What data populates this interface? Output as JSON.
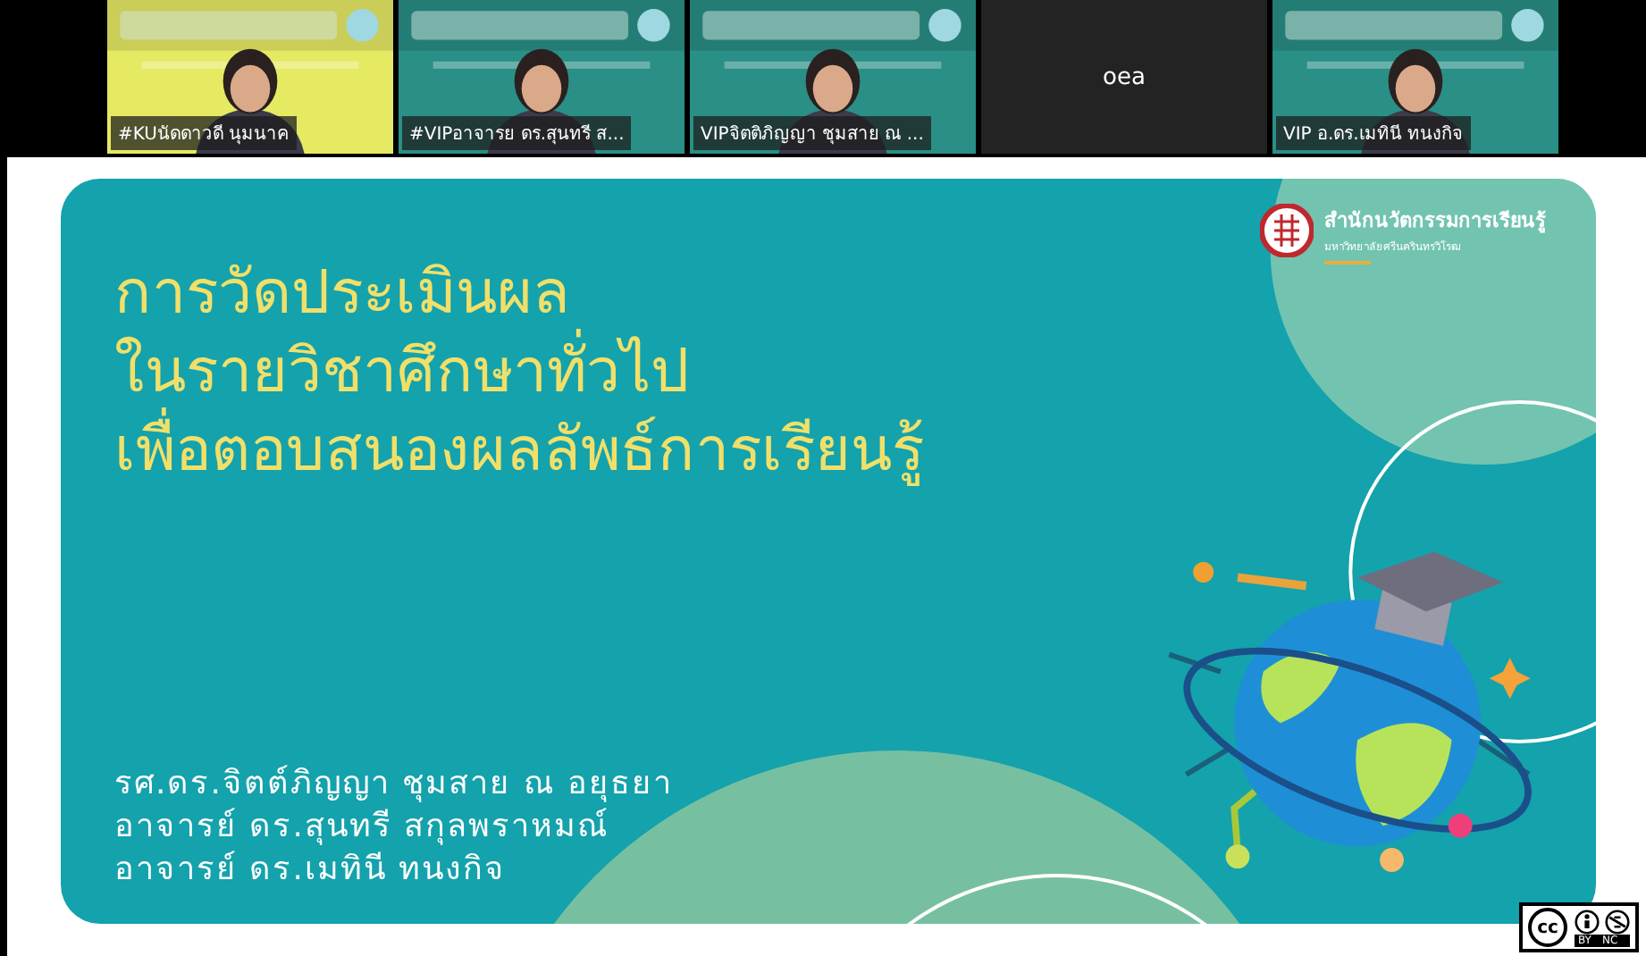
{
  "participants": [
    {
      "kind": "video",
      "name": "#KUนัดดาวดี นุมนาค",
      "color": "#e6ea63"
    },
    {
      "kind": "video",
      "name": "#VIPอาจารย ดร.สุนทรี ส...",
      "color": "#2a8f86"
    },
    {
      "kind": "video",
      "name": "VIPจิตติภิญญา ชุมสาย ณ ...",
      "color": "#2a8f86"
    },
    {
      "kind": "name_only",
      "name": "oea"
    },
    {
      "kind": "video",
      "name": "VIP อ.ดร.เมทินี ทนงกิจ",
      "color": "#2a8f86"
    }
  ],
  "slide": {
    "org": {
      "name": "สำนักนวัตกรรมการเรียนรู้",
      "subtitle": "มหาวิทยาลัยศรีนครินทรวิโรฒ"
    },
    "title_lines": [
      "การวัดประเมินผล",
      "ในรายวิชาศึกษาทั่วไป",
      "เพื่อตอบสนองผลลัพธ์การเรียนรู้"
    ],
    "authors": [
      "รศ.ดร.จิตต์ภิญญา ชุมสาย ณ อยุธยา",
      "อาจารย์ ดร.สุนทรี สกุลพราหมณ์",
      "อาจารย์ ดร.เมทินี ทนงกิจ"
    ]
  },
  "license": {
    "mark": "cc",
    "labels": [
      "BY",
      "NC"
    ]
  }
}
